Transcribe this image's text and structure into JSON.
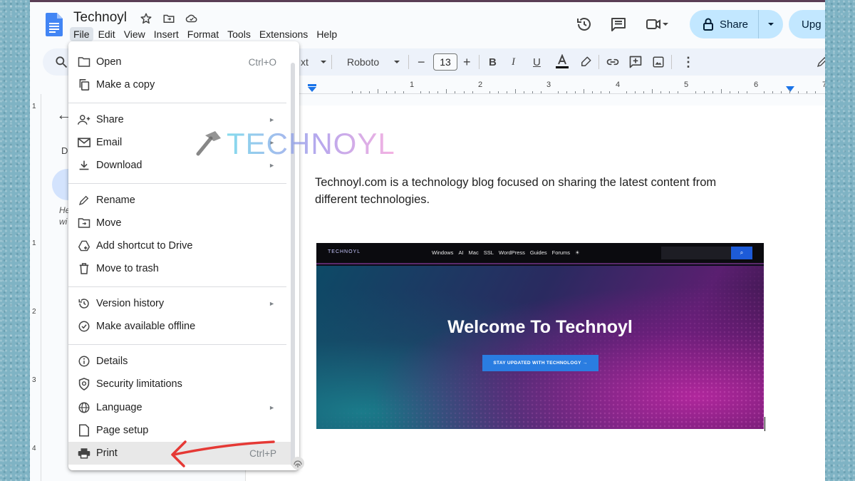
{
  "app": {
    "title": "Technoyl",
    "menubar": [
      "File",
      "Edit",
      "View",
      "Insert",
      "Format",
      "Tools",
      "Extensions",
      "Help"
    ],
    "active_menu": "File",
    "share_label": "Share",
    "upgrade_label": "Upg"
  },
  "toolbar": {
    "style_fragment": "xt",
    "font": "Roboto",
    "font_size": "13"
  },
  "ruler": {
    "numbers": [
      "1",
      "2",
      "3",
      "4",
      "5",
      "6",
      "7"
    ],
    "vertical_numbers": [
      "1",
      "1",
      "2",
      "3",
      "4"
    ]
  },
  "outline": {
    "letter": "D",
    "snippet_line1": "He",
    "snippet_line2": "wi"
  },
  "document": {
    "paragraph": "Technoyl.com is a technology blog focused on sharing the latest content from different technologies."
  },
  "embedded_image": {
    "logo": "TECHNOYL",
    "nav_links": [
      "Windows",
      "AI",
      "Mac",
      "SSL",
      "WordPress",
      "Guides",
      "Forums",
      "☀"
    ],
    "search_button": "⌕",
    "headline": "Welcome To Technoyl",
    "cta": "STAY UPDATED WITH TECHNOLOGY →"
  },
  "file_menu": {
    "open": {
      "label": "Open",
      "shortcut": "Ctrl+O"
    },
    "make_copy": {
      "label": "Make a copy"
    },
    "share": {
      "label": "Share"
    },
    "email": {
      "label": "Email"
    },
    "download": {
      "label": "Download"
    },
    "rename": {
      "label": "Rename"
    },
    "move": {
      "label": "Move"
    },
    "add_shortcut": {
      "label": "Add shortcut to Drive"
    },
    "move_trash": {
      "label": "Move to trash"
    },
    "version_history": {
      "label": "Version history"
    },
    "make_offline": {
      "label": "Make available offline"
    },
    "details": {
      "label": "Details"
    },
    "security": {
      "label": "Security limitations"
    },
    "language": {
      "label": "Language"
    },
    "page_setup": {
      "label": "Page setup"
    },
    "print": {
      "label": "Print",
      "shortcut": "Ctrl+P"
    },
    "submenu_arrow": "►"
  },
  "watermark": {
    "text": "TECHNOYL"
  },
  "colors": {
    "share_bg": "#c2e7ff",
    "toolbar_bg": "#edf2fa",
    "annotation_arrow": "#e53935",
    "menu_highlight": "#e8e8e8"
  }
}
